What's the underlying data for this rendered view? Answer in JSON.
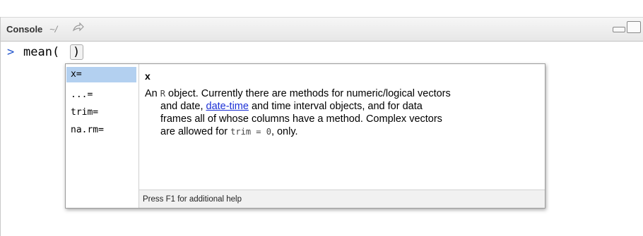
{
  "console": {
    "title": "Console",
    "path": "~/",
    "goto_icon": "arrow-goto-icon",
    "minimize_icon": "minimize-icon",
    "maximize_icon": "maximize-icon"
  },
  "prompt": ">",
  "command": "mean(",
  "cursor_char": ")",
  "popup": {
    "args": [
      "x=",
      "...=",
      "trim=",
      "na.rm="
    ],
    "selected_index": 0,
    "help_title": "x",
    "help": {
      "p1a": "An ",
      "p1_R": "R",
      "p1b": " object. Currently there are methods for numeric/logical vectors",
      "p2a": "and date, ",
      "p2_link": "date-time",
      "p2b": " and time interval objects, and for data",
      "p3": "frames all of whose columns have a method. Complex vectors",
      "p4a": "are allowed for ",
      "p4_code": "trim = 0",
      "p4b": ", only."
    },
    "footer": "Press F1 for additional help"
  },
  "colors": {
    "prompt": "#2255cc",
    "selection": "#b3d0f0",
    "link": "#1b2fd6"
  }
}
